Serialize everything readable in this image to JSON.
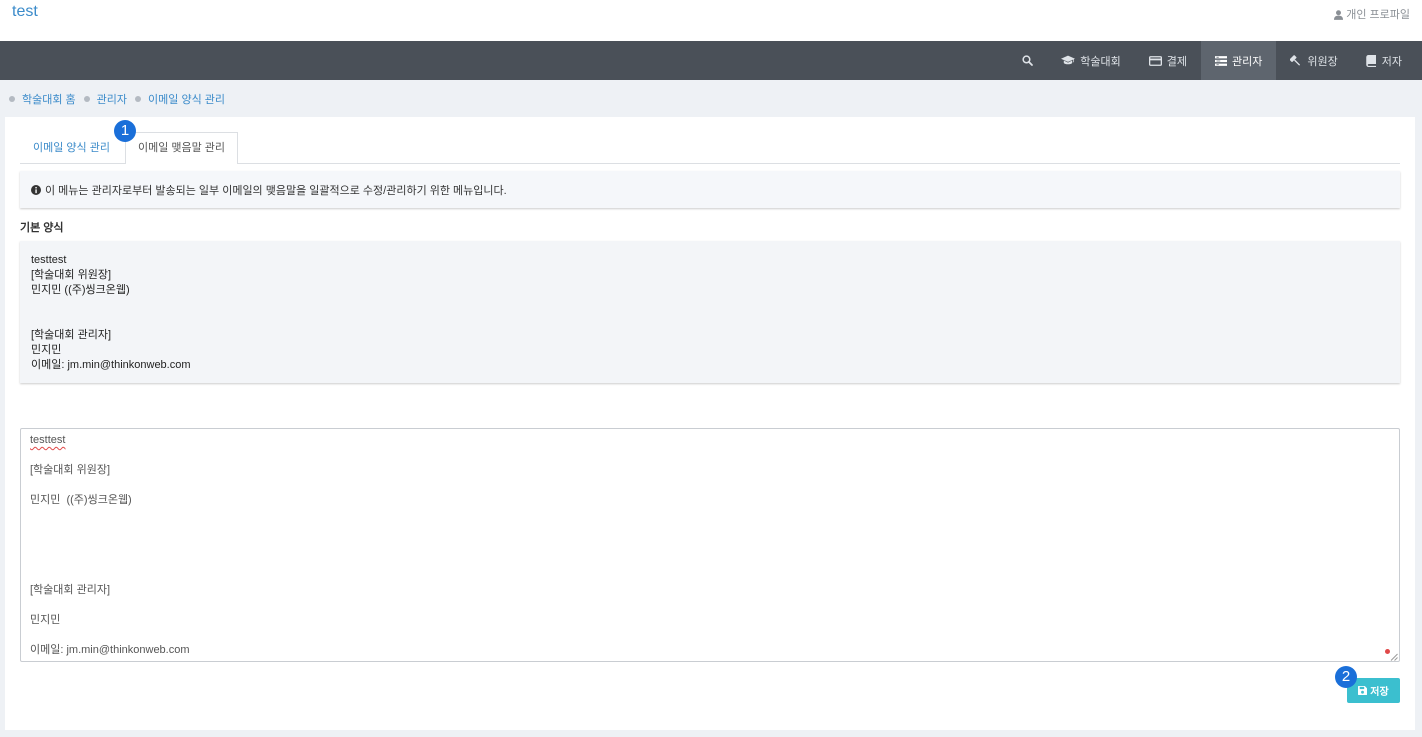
{
  "header": {
    "site_title": "test",
    "profile": {
      "icon": "user-icon",
      "label": "개인 프로파일"
    }
  },
  "nav": {
    "items": [
      {
        "icon": "search-icon"
      },
      {
        "icon": "graduation-cap-icon",
        "label": "학술대회"
      },
      {
        "icon": "credit-card-icon",
        "label": "결제"
      },
      {
        "icon": "list-icon",
        "label": "관리자",
        "active": true
      },
      {
        "icon": "gavel-icon",
        "label": "위원장"
      },
      {
        "icon": "book-icon",
        "label": "저자"
      }
    ]
  },
  "breadcrumb": {
    "items": [
      "학술대회 홈",
      "관리자",
      "이메일 양식 관리"
    ]
  },
  "tabs": [
    {
      "label": "이메일 양식 관리",
      "active": false
    },
    {
      "label": "이메일 맺음말 관리",
      "active": true
    }
  ],
  "info": {
    "icon": "info-circle-icon",
    "text": "이 메뉴는 관리자로부터 발송되는 일부 이메일의 맺음말을 일괄적으로 수정/관리하기 위한 메뉴입니다."
  },
  "default_template": {
    "heading": "기본 양식",
    "lines": [
      "testtest",
      "[학술대회 위원장]",
      "민지민 ((주)씽크온웹)",
      "",
      "",
      "[학술대회 관리자]",
      "민지민",
      "이메일: jm.min@thinkonweb.com"
    ]
  },
  "editor": {
    "lines": [
      "testtest",
      "[학술대회 위원장]",
      "민지민  ((주)씽크온웹)",
      "",
      "",
      "[학술대회 관리자]",
      "민지민",
      "이메일: jm.min@thinkonweb.com"
    ]
  },
  "save_button": {
    "icon": "save-icon",
    "label": "저장"
  },
  "annotations": {
    "step_1": "1",
    "step_2": "2"
  },
  "colors": {
    "accent_blue": "#3b8bca",
    "navbar": "#4a5058",
    "navbar_active": "#5e656e",
    "annotation_badge": "#1a6fd9",
    "save_button": "#3bbfcf",
    "spell_error": "#e04848"
  }
}
